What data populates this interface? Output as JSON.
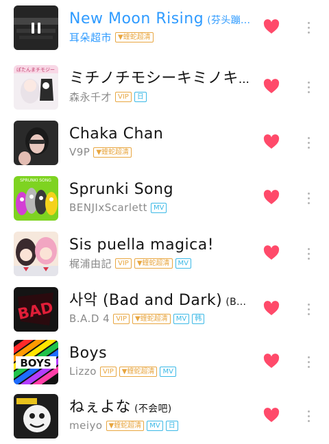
{
  "accent": "#2f9bff",
  "heart_color": "#ff4a6a",
  "songs": [
    {
      "title": "New Moon Rising",
      "title_sub": "(芬头蹦...",
      "artist": "耳朵超市",
      "tags": [
        "▼蝰蛇超清"
      ],
      "playing": true,
      "liked": true
    },
    {
      "title": "ミチノチモシーキミノキモチ",
      "title_sub": "…",
      "artist": "森永千才",
      "tags": [
        "VIP",
        "日"
      ],
      "playing": false,
      "liked": true
    },
    {
      "title": "Chaka Chan",
      "title_sub": "",
      "artist": "V9P",
      "tags": [
        "▼蝰蛇超清"
      ],
      "playing": false,
      "liked": true
    },
    {
      "title": "Sprunki Song",
      "title_sub": "",
      "artist": "BENJIxScarlett",
      "tags": [
        "MV"
      ],
      "playing": false,
      "liked": true
    },
    {
      "title": "Sis puella magica!",
      "title_sub": "",
      "artist": "梶浦由記",
      "tags": [
        "VIP",
        "▼蝰蛇超清",
        "MV"
      ],
      "playing": false,
      "liked": true
    },
    {
      "title": "사악 (Bad and Dark)",
      "title_sub": "(B...",
      "artist": "B.A.D 4",
      "tags": [
        "VIP",
        "▼蝰蛇超清",
        "MV",
        "韩"
      ],
      "playing": false,
      "liked": true
    },
    {
      "title": "Boys",
      "title_sub": "",
      "artist": "Lizzo",
      "tags": [
        "VIP",
        "▼蝰蛇超清",
        "MV"
      ],
      "playing": false,
      "liked": true
    },
    {
      "title": "ねぇよな",
      "title_sub": "(不会吧)",
      "artist": "meiyo",
      "tags": [
        "▼蝰蛇超清",
        "MV",
        "日"
      ],
      "playing": false,
      "liked": true
    }
  ],
  "cover_art": [
    {
      "icon": "album-cover-dark-lettering"
    },
    {
      "icon": "album-cover-anime-girl",
      "label": "ぽたんまチモジー"
    },
    {
      "icon": "album-cover-portrait"
    },
    {
      "icon": "album-cover-sprunki",
      "label": "SPRUNKI SONG"
    },
    {
      "icon": "album-cover-anime-duo"
    },
    {
      "icon": "album-cover-bad-logo",
      "label": "BAD"
    },
    {
      "icon": "album-cover-boys",
      "label": "BOYS"
    },
    {
      "icon": "album-cover-meiyo"
    }
  ]
}
